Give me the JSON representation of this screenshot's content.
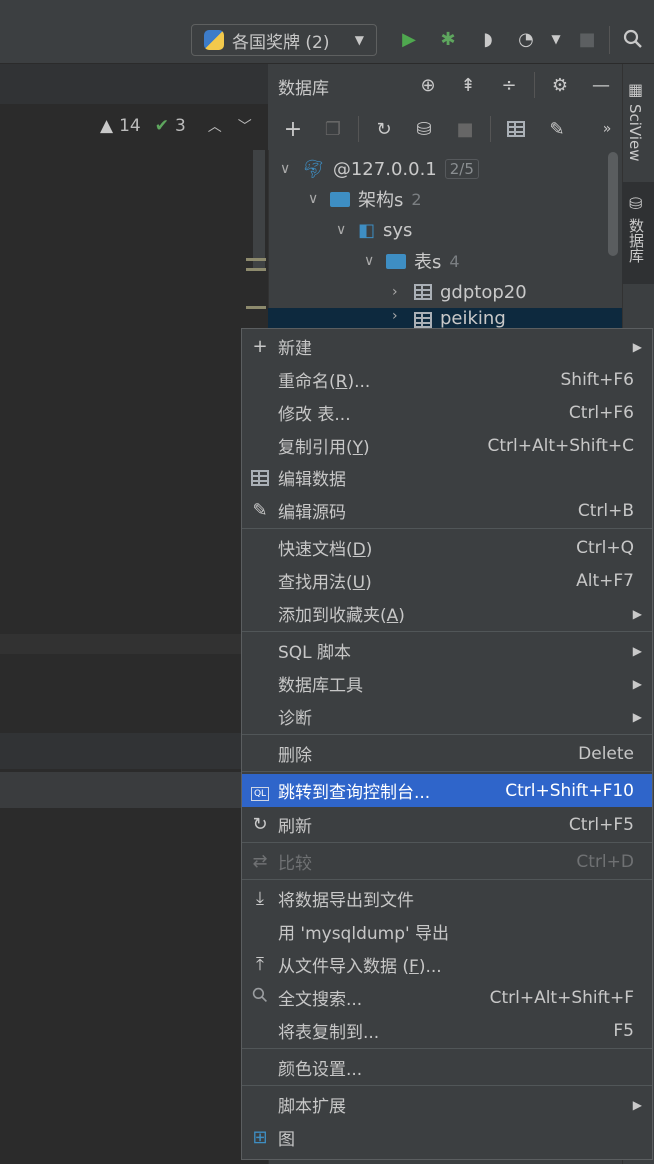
{
  "toolbar": {
    "run_config": "各国奖牌 (2)",
    "icons": [
      "python-icon",
      "run-icon",
      "debug-icon",
      "coverage-icon",
      "profile-icon",
      "stop-icon",
      "search-icon"
    ]
  },
  "editor": {
    "warnings": "14",
    "checks": "3"
  },
  "db_panel": {
    "title": "数据库",
    "tree": {
      "host": "@127.0.0.1",
      "host_badge": "2/5",
      "schemas": "架构s",
      "schemas_count": "2",
      "schema": "sys",
      "tables": "表s",
      "tables_count": "4",
      "table1": "gdptop20",
      "table2": "peiking"
    }
  },
  "right_stripe": {
    "tab1": "SciView",
    "tab2": "数据库"
  },
  "menu": {
    "new": "新建",
    "rename_label": "重命名(",
    "rename_key": "R",
    "rename_suffix": ")...",
    "rename_sc": "Shift+F6",
    "modify": "修改 表...",
    "modify_sc": "Ctrl+F6",
    "copyref_label": "复制引用(",
    "copyref_key": "Y",
    "copyref_suffix": ")",
    "copyref_sc": "Ctrl+Alt+Shift+C",
    "edit_data": "编辑数据",
    "edit_source": "编辑源码",
    "edit_source_sc": "Ctrl+B",
    "quickdoc_label": "快速文档(",
    "quickdoc_key": "D",
    "quickdoc_suffix": ")",
    "quickdoc_sc": "Ctrl+Q",
    "findusages_label": "查找用法(",
    "findusages_key": "U",
    "findusages_suffix": ")",
    "findusages_sc": "Alt+F7",
    "addfav_label": "添加到收藏夹(",
    "addfav_key": "A",
    "addfav_suffix": ")",
    "sql_scripts": "SQL 脚本",
    "db_tools": "数据库工具",
    "diagnose": "诊断",
    "delete": "删除",
    "delete_sc": "Delete",
    "jump_console": "跳转到查询控制台...",
    "jump_console_sc": "Ctrl+Shift+F10",
    "refresh": "刷新",
    "refresh_sc": "Ctrl+F5",
    "compare": "比较",
    "compare_sc": "Ctrl+D",
    "export_file": "将数据导出到文件",
    "mysqldump": "用 'mysqldump' 导出",
    "import_label": "从文件导入数据 (",
    "import_key": "F",
    "import_suffix": ")...",
    "fulltext": "全文搜索...",
    "fulltext_sc": "Ctrl+Alt+Shift+F",
    "copy_table": "将表复制到...",
    "copy_table_sc": "F5",
    "color": "颜色设置...",
    "script_ext": "脚本扩展",
    "diagram": "图"
  }
}
